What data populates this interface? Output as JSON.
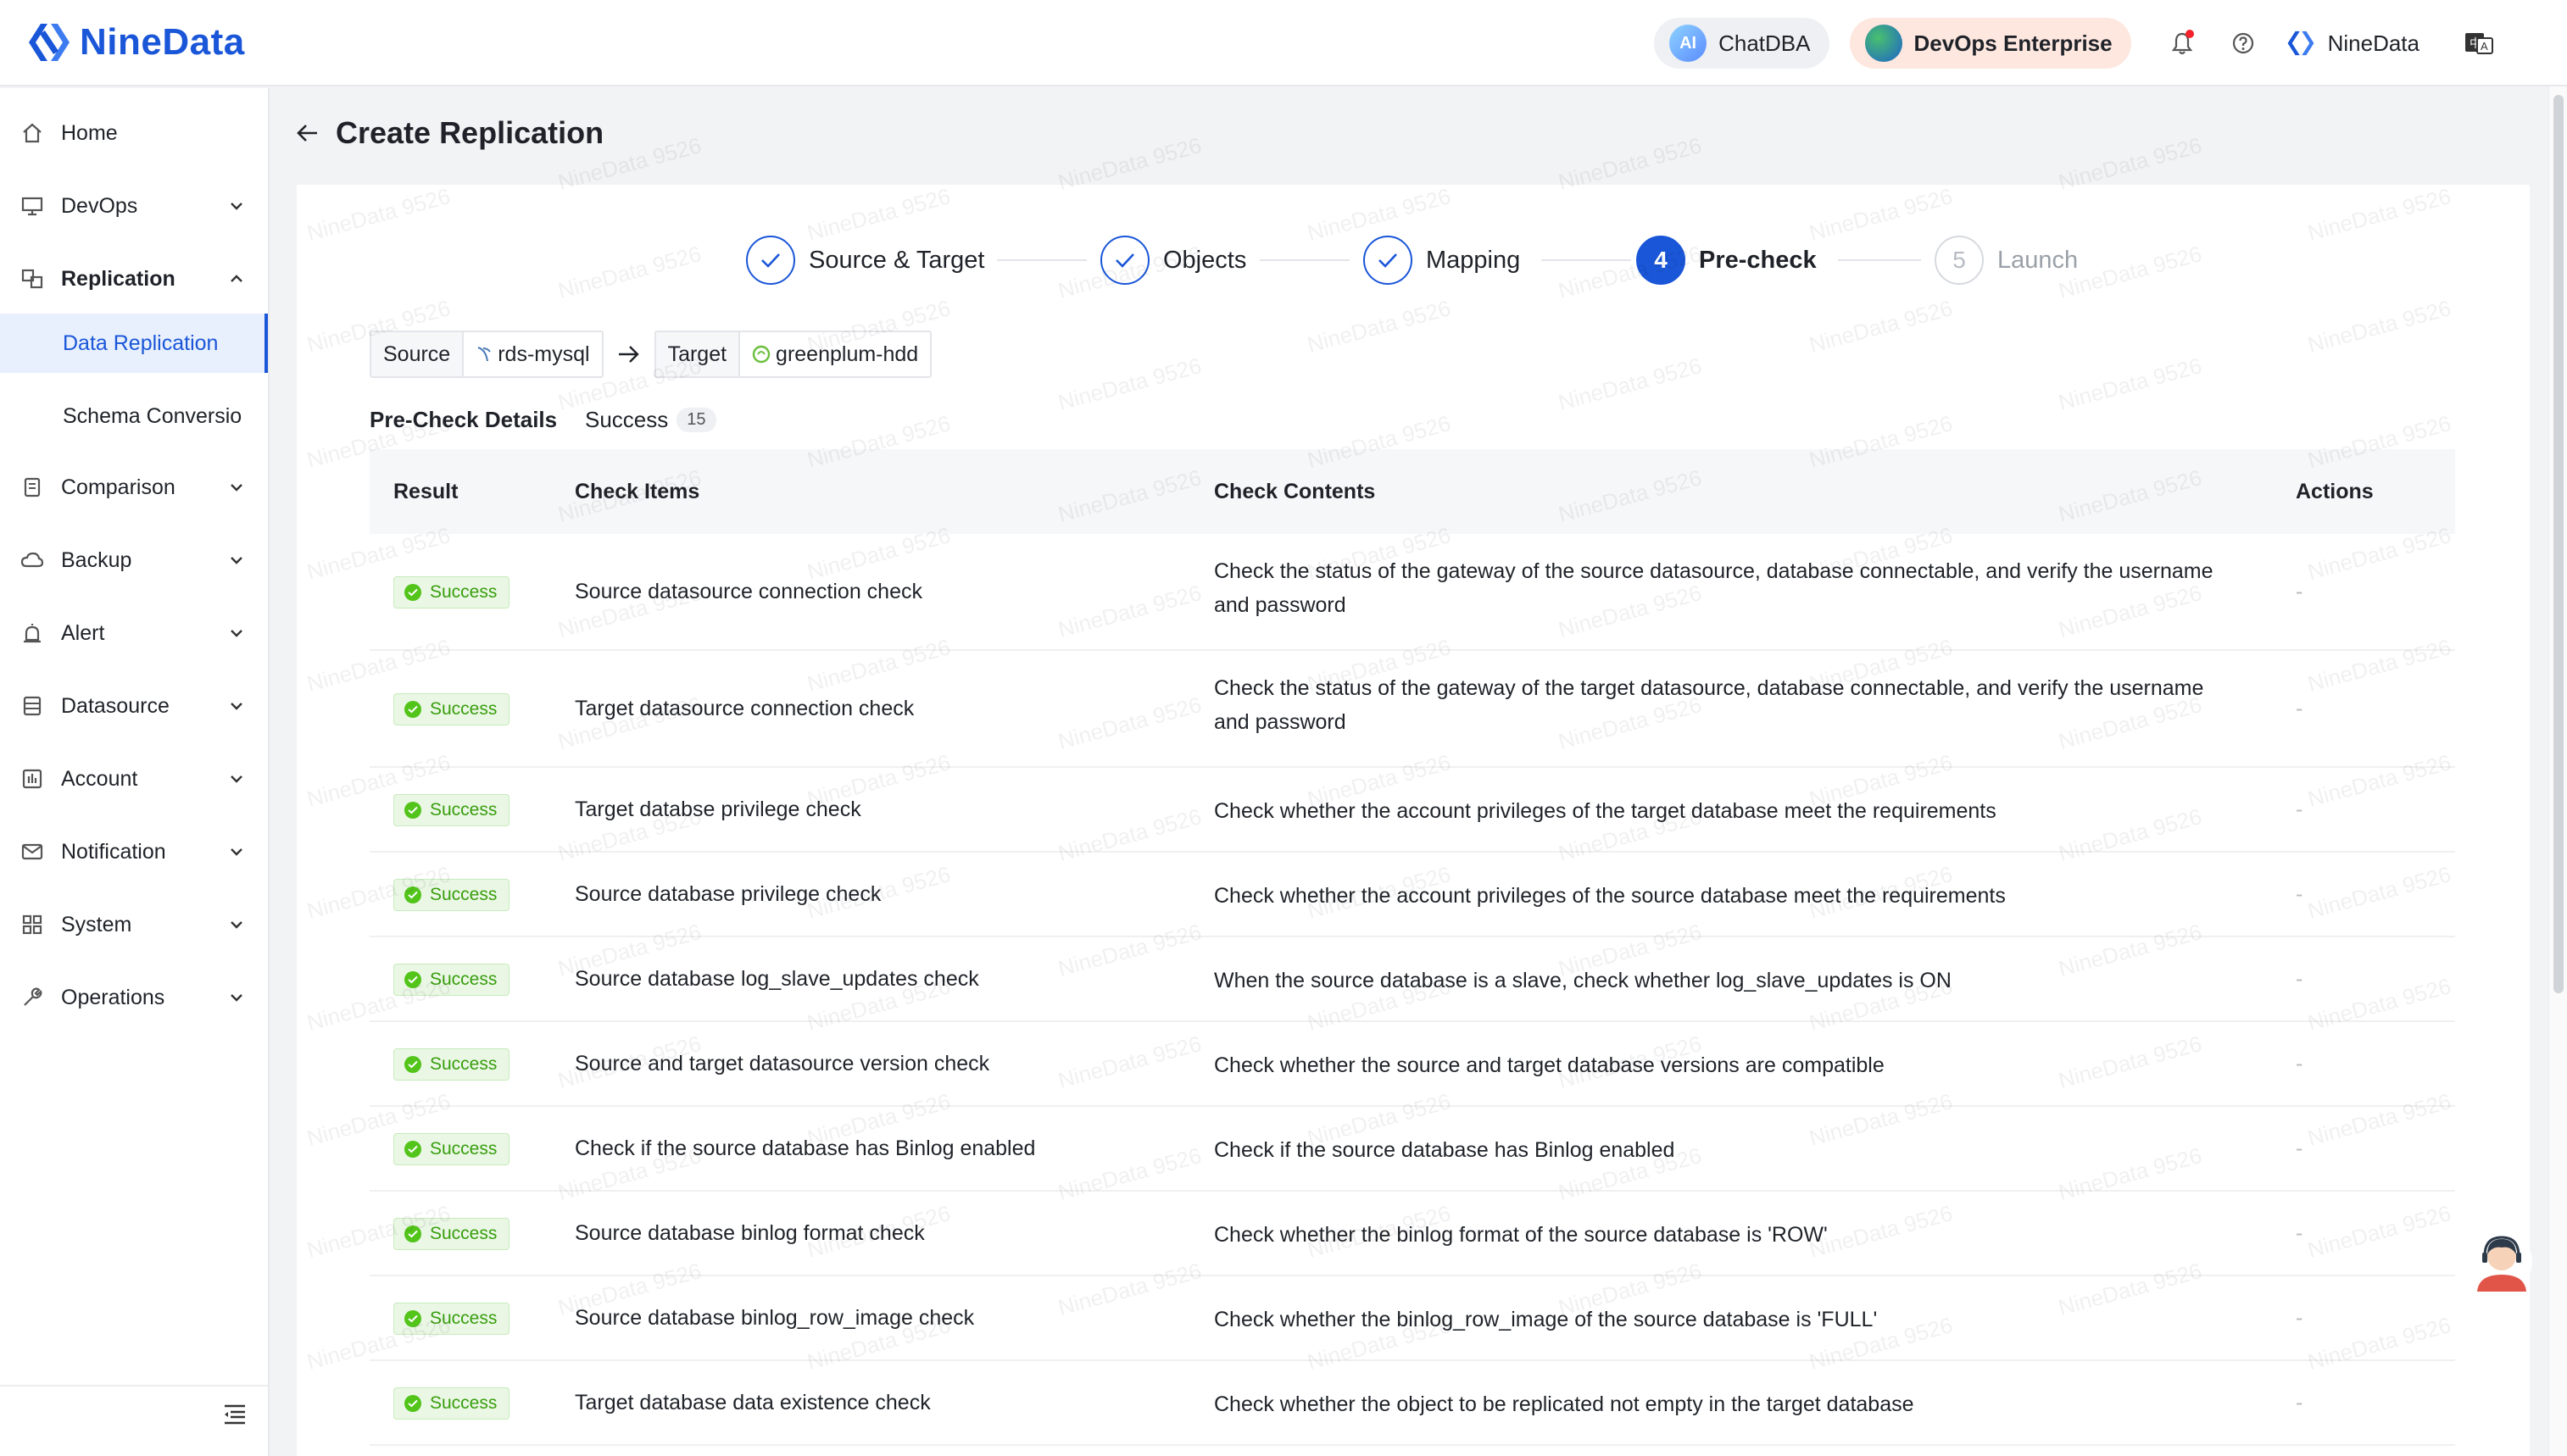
{
  "app": {
    "logo_text": "NineData",
    "brand_color": "#1a56d8"
  },
  "header": {
    "chatdba_label": "ChatDBA",
    "chatdba_icon_text": "AI",
    "devops_label": "DevOps Enterprise",
    "user_name": "NineData",
    "icons": [
      "bell-icon",
      "help-icon",
      "language-icon"
    ]
  },
  "sidebar": {
    "items": [
      {
        "label": "Home",
        "icon": "home-icon"
      },
      {
        "label": "DevOps",
        "icon": "monitor-icon"
      },
      {
        "label": "Replication",
        "icon": "replication-icon"
      },
      {
        "label": "Data Replication"
      },
      {
        "label": "Schema Conversio"
      },
      {
        "label": "Comparison",
        "icon": "document-icon"
      },
      {
        "label": "Backup",
        "icon": "cloud-icon"
      },
      {
        "label": "Alert",
        "icon": "alarm-icon"
      },
      {
        "label": "Datasource",
        "icon": "database-icon"
      },
      {
        "label": "Account",
        "icon": "account-icon"
      },
      {
        "label": "Notification",
        "icon": "mail-icon"
      },
      {
        "label": "System",
        "icon": "grid-icon"
      },
      {
        "label": "Operations",
        "icon": "wrench-icon"
      }
    ]
  },
  "page": {
    "title": "Create Replication",
    "steps": [
      {
        "label": "Source & Target",
        "state": "done"
      },
      {
        "label": "Objects",
        "state": "done"
      },
      {
        "label": "Mapping",
        "state": "done"
      },
      {
        "label": "Pre-check",
        "number": "4",
        "state": "current"
      },
      {
        "label": "Launch",
        "number": "5",
        "state": "pending"
      }
    ],
    "source_label": "Source",
    "source_value": "rds-mysql",
    "target_label": "Target",
    "target_value": "greenplum-hdd",
    "precheck_title": "Pre-Check Details",
    "success_label": "Success",
    "success_count": "15",
    "watermark": "NineData 9526"
  },
  "table": {
    "headers": [
      "Result",
      "Check Items",
      "Check Contents",
      "Actions"
    ],
    "rows": [
      {
        "result": "Success",
        "item": "Source datasource connection check",
        "contents": "Check the status of the gateway of the source datasource, database connectable, and verify the username and password",
        "action": "-"
      },
      {
        "result": "Success",
        "item": "Target datasource connection check",
        "contents": "Check the status of the gateway of the target datasource, database connectable, and verify the username and password",
        "action": "-"
      },
      {
        "result": "Success",
        "item": "Target databse privilege check",
        "contents": "Check whether the account privileges of the target database meet the requirements",
        "action": "-"
      },
      {
        "result": "Success",
        "item": "Source database privilege check",
        "contents": "Check whether the account privileges of the source database meet the requirements",
        "action": "-"
      },
      {
        "result": "Success",
        "item": "Source database log_slave_updates check",
        "contents": "When the source database is a slave, check whether log_slave_updates is ON",
        "action": "-"
      },
      {
        "result": "Success",
        "item": "Source and target datasource version check",
        "contents": "Check whether the source and target database versions are compatible",
        "action": "-"
      },
      {
        "result": "Success",
        "item": "Check if the source database has Binlog enabled",
        "contents": "Check if the source database has Binlog enabled",
        "action": "-"
      },
      {
        "result": "Success",
        "item": "Source database binlog format check",
        "contents": "Check whether the binlog format of the source database is 'ROW'",
        "action": "-"
      },
      {
        "result": "Success",
        "item": "Source database binlog_row_image check",
        "contents": "Check whether the binlog_row_image of the source database is 'FULL'",
        "action": "-"
      },
      {
        "result": "Success",
        "item": "Target database data existence check",
        "contents": "Check whether the object to be replicated not empty in the target database",
        "action": "-"
      }
    ]
  }
}
